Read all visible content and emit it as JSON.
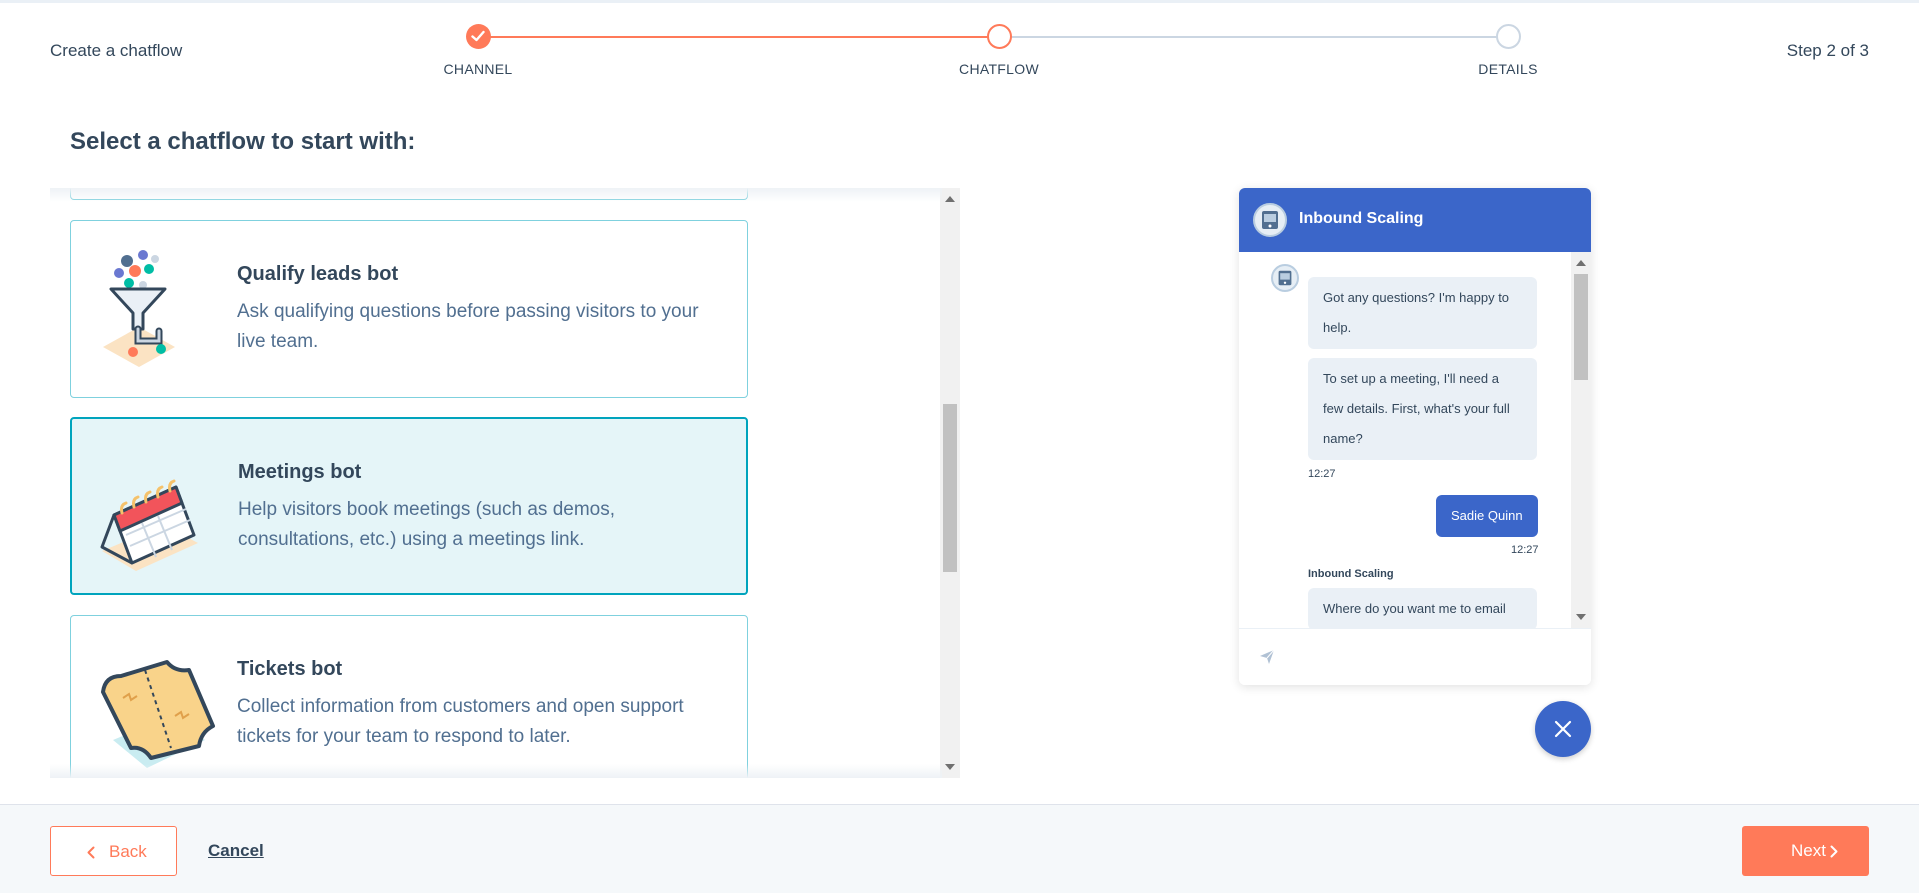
{
  "header": {
    "title": "Create a chatflow",
    "step_indicator": "Step 2 of 3",
    "steps": [
      {
        "label": "CHANNEL",
        "state": "complete"
      },
      {
        "label": "CHATFLOW",
        "state": "current"
      },
      {
        "label": "DETAILS",
        "state": "upcoming"
      }
    ]
  },
  "main": {
    "section_title": "Select a chatflow to start with:",
    "chatflows": [
      {
        "title": "Qualify leads bot",
        "description": "Ask qualifying questions before passing visitors to your live team.",
        "icon": "funnel-icon",
        "selected": false
      },
      {
        "title": "Meetings bot",
        "description": "Help visitors book meetings (such as demos, consultations, etc.) using a meetings link.",
        "icon": "calendar-icon",
        "selected": true
      },
      {
        "title": "Tickets bot",
        "description": "Collect information from customers and open support tickets for your team to respond to later.",
        "icon": "ticket-icon",
        "selected": false
      }
    ]
  },
  "preview": {
    "bot_name": "Inbound Scaling",
    "messages": [
      {
        "from": "bot",
        "text": "Got any questions? I'm happy to help."
      },
      {
        "from": "bot",
        "text": "To set up a meeting, I'll need a few details. First, what's your full name?"
      },
      {
        "from": "bot_time",
        "text": "12:27"
      },
      {
        "from": "user",
        "text": "Sadie Quinn"
      },
      {
        "from": "user_time",
        "text": "12:27"
      },
      {
        "from": "sender",
        "text": "Inbound Scaling"
      },
      {
        "from": "bot",
        "text": "Where do you want me to email"
      }
    ],
    "send_icon": "send-icon",
    "close_icon": "close-icon"
  },
  "footer": {
    "back_label": "Back",
    "cancel_label": "Cancel",
    "next_label": "Next"
  },
  "colors": {
    "accent": "#ff7a59",
    "chat_blue": "#3b66c9",
    "selected_border": "#00a4bd",
    "selected_bg": "#e5f5f8",
    "card_border": "#7fd1de"
  }
}
